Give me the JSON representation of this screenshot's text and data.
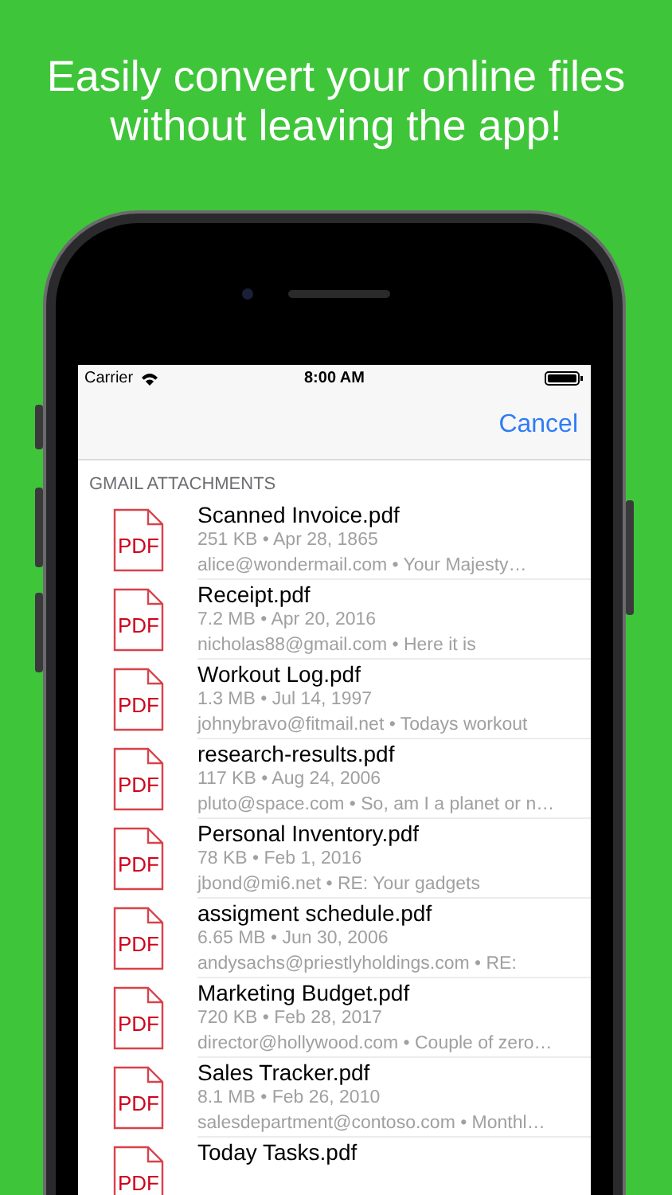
{
  "headline": [
    "Easily convert your online files",
    "without leaving the app!"
  ],
  "status_bar": {
    "carrier": "Carrier",
    "time": "8:00 AM"
  },
  "nav_bar": {
    "cancel": "Cancel"
  },
  "section": {
    "title": "GMAIL ATTACHMENTS",
    "files": [
      {
        "icon_label": "PDF",
        "name": "Scanned Invoice.pdf",
        "meta": "251 KB • Apr 28, 1865",
        "detail": "alice@wondermail.com • Your Majesty…"
      },
      {
        "icon_label": "PDF",
        "name": "Receipt.pdf",
        "meta": "7.2 MB • Apr 20, 2016",
        "detail": "nicholas88@gmail.com • Here it is"
      },
      {
        "icon_label": "PDF",
        "name": "Workout Log.pdf",
        "meta": "1.3 MB • Jul 14, 1997",
        "detail": "johnybravo@fitmail.net • Todays workout"
      },
      {
        "icon_label": "PDF",
        "name": "research-results.pdf",
        "meta": "117 KB • Aug 24, 2006",
        "detail": "pluto@space.com • So, am I a planet or n…"
      },
      {
        "icon_label": "PDF",
        "name": "Personal Inventory.pdf",
        "meta": "78 KB • Feb 1, 2016",
        "detail": "jbond@mi6.net • RE: Your gadgets"
      },
      {
        "icon_label": "PDF",
        "name": "assigment schedule.pdf",
        "meta": "6.65 MB • Jun 30, 2006",
        "detail": "andysachs@priestlyholdings.com • RE:"
      },
      {
        "icon_label": "PDF",
        "name": "Marketing Budget.pdf",
        "meta": "720 KB • Feb 28, 2017",
        "detail": "director@hollywood.com • Couple of zero…"
      },
      {
        "icon_label": "PDF",
        "name": "Sales Tracker.pdf",
        "meta": "8.1 MB • Feb 26, 2010",
        "detail": "salesdepartment@contoso.com • Monthl…"
      },
      {
        "icon_label": "PDF",
        "name": "Today Tasks.pdf"
      }
    ]
  }
}
